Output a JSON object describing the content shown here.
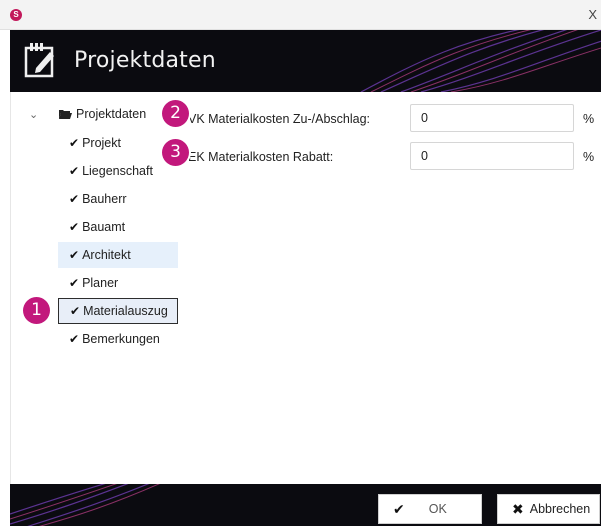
{
  "window": {
    "app_icon": "app-logo-icon",
    "close_label": "X"
  },
  "header": {
    "title": "Projektdaten",
    "icon": "edit-document-icon"
  },
  "tree": {
    "root": {
      "label": "Projektdaten",
      "icon": "folder-open-icon",
      "chevron": "chevron-down-icon"
    },
    "items": [
      {
        "label": "Projekt"
      },
      {
        "label": "Liegenschaft"
      },
      {
        "label": "Bauherr"
      },
      {
        "label": "Bauamt"
      },
      {
        "label": "Architekt",
        "state": "hover"
      },
      {
        "label": "Planer"
      },
      {
        "label": "Materialauszug",
        "state": "selected"
      },
      {
        "label": "Bemerkungen"
      }
    ],
    "check_glyph": "✔"
  },
  "form": {
    "fields": [
      {
        "label": "VK Materialkosten Zu-/Abschlag:",
        "value": "0",
        "unit": "%"
      },
      {
        "label": "EK Materialkosten Rabatt:",
        "value": "0",
        "unit": "%"
      }
    ]
  },
  "badges": [
    "1",
    "2",
    "3"
  ],
  "footer": {
    "ok_label": "OK",
    "ok_icon": "check-icon",
    "cancel_label": "Abbrechen",
    "cancel_icon": "close-icon"
  },
  "colors": {
    "badge": "#c2187c",
    "header_bg": "#0b0b10",
    "selection": "#e6f0fb"
  }
}
